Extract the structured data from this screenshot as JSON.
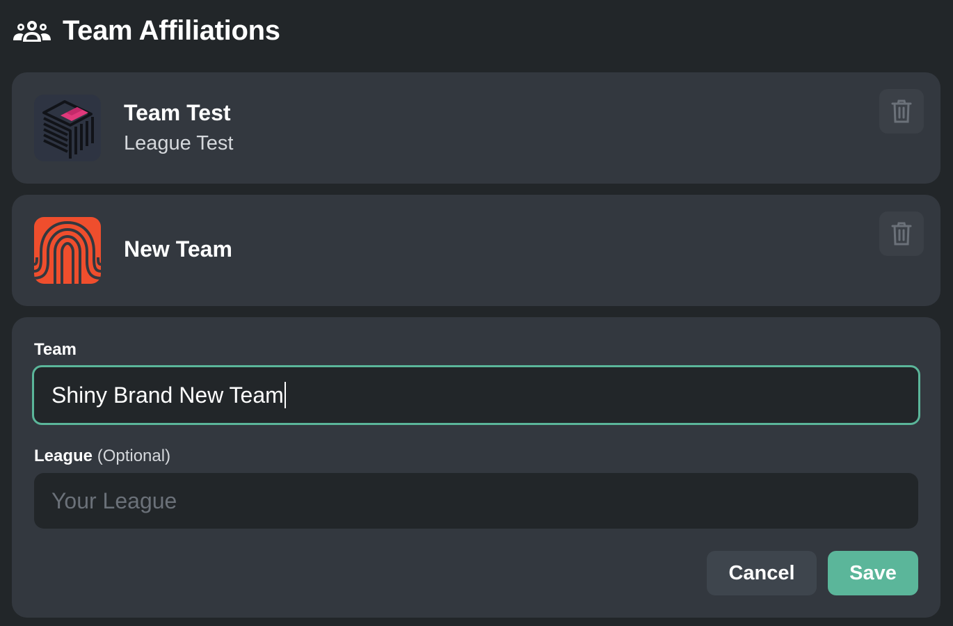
{
  "section": {
    "title": "Team Affiliations",
    "icon": "users-icon"
  },
  "teams": [
    {
      "name": "Team Test",
      "league": "League Test",
      "logo": "isometric-cube-logo",
      "delete_icon": "trash-icon"
    },
    {
      "name": "New Team",
      "league": "",
      "logo": "fingerprint-arch-logo",
      "delete_icon": "trash-icon"
    }
  ],
  "form": {
    "team_label": "Team",
    "team_value": "Shiny Brand New Team",
    "league_label": "League",
    "league_optional": "(Optional)",
    "league_value": "",
    "league_placeholder": "Your League",
    "cancel_label": "Cancel",
    "save_label": "Save"
  },
  "colors": {
    "background": "#222629",
    "card": "#33383f",
    "accent": "#5bb69a",
    "logo_orange": "#ef4e2d",
    "logo_pink": "#e0397b"
  }
}
